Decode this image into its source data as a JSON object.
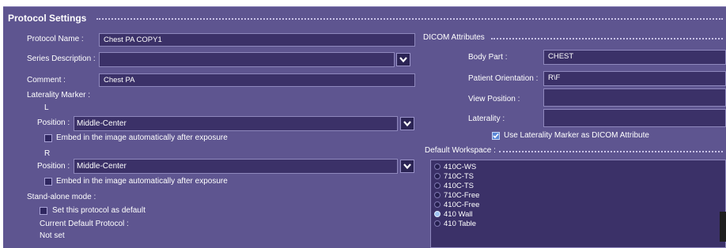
{
  "section_title": "Protocol Settings",
  "protocol_name": {
    "label": "Protocol Name :",
    "value": "Chest PA COPY1"
  },
  "series_description": {
    "label": "Series Description :",
    "value": ""
  },
  "comment": {
    "label": "Comment :",
    "value": "Chest PA"
  },
  "laterality_marker": {
    "label": "Laterality Marker :",
    "left": {
      "heading": "L",
      "position_label": "Position :",
      "position_value": "Middle-Center",
      "embed_label": "Embed in the image automatically after exposure",
      "embed_checked": false
    },
    "right": {
      "heading": "R",
      "position_label": "Position :",
      "position_value": "Middle-Center",
      "embed_label": "Embed in the image automatically after exposure",
      "embed_checked": false
    }
  },
  "standalone": {
    "label": "Stand-alone mode :",
    "set_default_label": "Set this protocol as default",
    "set_default_checked": false,
    "current_default_label": "Current Default Protocol :",
    "current_default_value": "Not set"
  },
  "dicom": {
    "title": "DICOM Attributes",
    "body_part": {
      "label": "Body Part :",
      "value": "CHEST"
    },
    "patient_orientation": {
      "label": "Patient Orientation :",
      "value": "R\\F"
    },
    "view_position": {
      "label": "View Position :",
      "value": ""
    },
    "laterality": {
      "label": "Laterality :",
      "value": ""
    },
    "use_marker_label": "Use Laterality Marker as DICOM Attribute",
    "use_marker_checked": true
  },
  "default_workspace": {
    "label": "Default Workspace :",
    "selected": "410 Wall",
    "items": [
      "410C-WS",
      "710C-TS",
      "410C-TS",
      "710C-Free",
      "410C-Free",
      "410 Wall",
      "410 Table"
    ]
  },
  "colors": {
    "panel_bg": "#5e5590",
    "field_bg": "#3b3168",
    "field_border": "#8f88bd",
    "checked_accent": "#5a86d6"
  }
}
